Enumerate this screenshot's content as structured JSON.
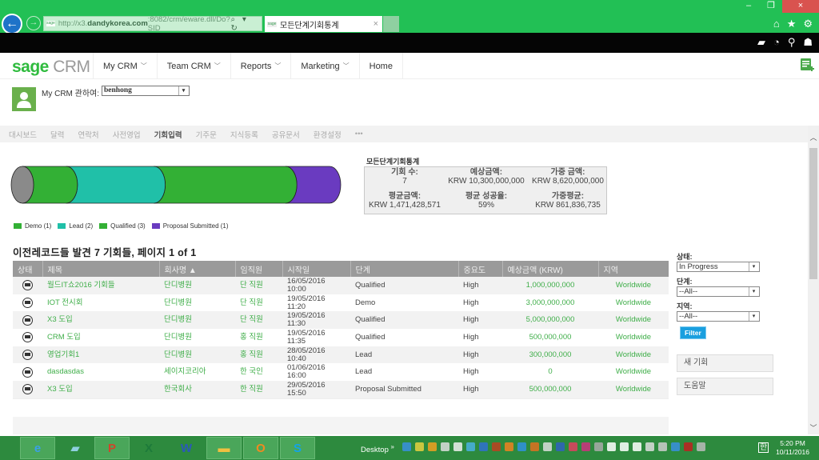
{
  "browser": {
    "url_prefix": "http://x3.",
    "url_domain": "dandykorea.com",
    "url_suffix": ":8082/crm/eware.dll/Do?SID",
    "url_favicon": "sage",
    "addr_controls": "⌕ ▾ ↻",
    "tab_title": "모든단계기회통계",
    "tab_favicon": "sage",
    "tab_close": "×",
    "back": "←",
    "forward": "→",
    "win_minimize": "–",
    "win_restore": "❐",
    "win_close": "×",
    "tools": {
      "home": "⌂",
      "favorites": "★",
      "settings": "⚙"
    }
  },
  "crm_topbar_icons": {
    "notifications": "▰",
    "recent": "◔",
    "search": "⚲",
    "user": "☗"
  },
  "nav": {
    "logo_sage": "sage",
    "logo_crm": " CRM",
    "items": [
      {
        "label": "My CRM",
        "chevron": "﹀"
      },
      {
        "label": "Team CRM",
        "chevron": "﹀"
      },
      {
        "label": "Reports",
        "chevron": "﹀"
      },
      {
        "label": "Marketing",
        "chevron": "﹀"
      },
      {
        "label": "Home",
        "chevron": ""
      }
    ]
  },
  "context": {
    "label": "My CRM 관하여:",
    "selected_user": "benhong",
    "dropdown_glyph": "▾"
  },
  "subtabs": [
    {
      "label": "대시보드",
      "active": false
    },
    {
      "label": "달력",
      "active": false
    },
    {
      "label": "연락처",
      "active": false
    },
    {
      "label": "사전영업",
      "active": false
    },
    {
      "label": "기회입력",
      "active": true
    },
    {
      "label": "기주문",
      "active": false
    },
    {
      "label": "지식등록",
      "active": false
    },
    {
      "label": "공유문서",
      "active": false
    },
    {
      "label": "환경설정",
      "active": false
    },
    {
      "label": "•••",
      "active": false
    }
  ],
  "scrollbar": {
    "up": "︿",
    "down": "﹀"
  },
  "chart_data": {
    "type": "bar",
    "title": "",
    "orientation": "horizontal-stacked-pipeline",
    "categories": [
      "Demo",
      "Lead",
      "Qualified",
      "Proposal Submitted"
    ],
    "values": [
      1,
      2,
      3,
      1
    ],
    "colors": [
      "#33b035",
      "#20c0a8",
      "#33b035",
      "#6a3bc0"
    ],
    "legend": [
      "Demo (1)",
      "Lead (2)",
      "Qualified (3)",
      "Proposal Submitted (1)"
    ],
    "legend_position": "bottom-left",
    "end_cap_color": "#8a8a8a"
  },
  "stats": {
    "title": "모든단계기회통계",
    "items": [
      {
        "label": "기회 수:",
        "value": "7"
      },
      {
        "label": "예상금액:",
        "value": "KRW 10,300,000,000"
      },
      {
        "label": "가중 금액:",
        "value": "KRW 8,620,000,000"
      },
      {
        "label": "평균금액:",
        "value": "KRW 1,471,428,571"
      },
      {
        "label": "평균 성공율:",
        "value": "59%"
      },
      {
        "label": "가중평균:",
        "value": "KRW 861,836,735"
      }
    ]
  },
  "list": {
    "title": "이전레코드들 발견 7 기회들, 페이지 1 of 1",
    "columns": [
      "상태",
      "제목",
      "회사명 ▲",
      "임직원",
      "시작일",
      "단계",
      "중요도",
      "예상금액 (KRW)",
      "지역"
    ],
    "rows": [
      {
        "title": "월드IT쇼2016 기회들",
        "company": "단디병원",
        "person": "단 직원",
        "date": "16/05/2016",
        "time": "10:00",
        "stage": "Qualified",
        "priority": "High",
        "amount": "1,000,000,000",
        "region": "Worldwide"
      },
      {
        "title": "IOT 전시회",
        "company": "단디병원",
        "person": "단 직원",
        "date": "19/05/2016",
        "time": "11:20",
        "stage": "Demo",
        "priority": "High",
        "amount": "3,000,000,000",
        "region": "Worldwide"
      },
      {
        "title": "X3 도입",
        "company": "단디병원",
        "person": "단 직원",
        "date": "19/05/2016",
        "time": "11:30",
        "stage": "Qualified",
        "priority": "High",
        "amount": "5,000,000,000",
        "region": "Worldwide"
      },
      {
        "title": "CRM 도입",
        "company": "단디병원",
        "person": "홍 직원",
        "date": "19/05/2016",
        "time": "11:35",
        "stage": "Qualified",
        "priority": "High",
        "amount": "500,000,000",
        "region": "Worldwide"
      },
      {
        "title": "영업기회1",
        "company": "단디병원",
        "person": "홍 직원",
        "date": "28/05/2016",
        "time": "10:40",
        "stage": "Lead",
        "priority": "High",
        "amount": "300,000,000",
        "region": "Worldwide"
      },
      {
        "title": "dasdasdas",
        "company": "세이지코리아",
        "person": "한 국인",
        "date": "01/06/2016",
        "time": "16:00",
        "stage": "Lead",
        "priority": "High",
        "amount": "0",
        "region": "Worldwide"
      },
      {
        "title": "X3 도입",
        "company": "한국회사",
        "person": "한 직원",
        "date": "29/05/2016",
        "time": "15:50",
        "stage": "Proposal Submitted",
        "priority": "High",
        "amount": "500,000,000",
        "region": "Worldwide"
      }
    ]
  },
  "filters": {
    "status_label": "상태:",
    "status_value": "In Progress",
    "stage_label": "단계:",
    "stage_value": "--All--",
    "region_label": "지역:",
    "region_value": "--All--",
    "dropdown_glyph": "▾",
    "filter_button": "Filter"
  },
  "actions": {
    "new_opportunity": "새 기회",
    "help": "도움말"
  },
  "taskbar": {
    "apps": [
      {
        "name": "internet-explorer",
        "glyph": "e",
        "color": "#3aa0e8"
      },
      {
        "name": "notes",
        "glyph": "▰",
        "color": "#8fd0e0"
      },
      {
        "name": "powerpoint",
        "glyph": "P",
        "color": "#d0452a"
      },
      {
        "name": "excel",
        "glyph": "X",
        "color": "#1d7a3a"
      },
      {
        "name": "word",
        "glyph": "W",
        "color": "#2a5ab8"
      },
      {
        "name": "file-explorer",
        "glyph": "▬",
        "color": "#f0c040"
      },
      {
        "name": "outlook",
        "glyph": "O",
        "color": "#f08a20"
      },
      {
        "name": "skype",
        "glyph": "S",
        "color": "#12a4e8"
      }
    ],
    "desktop_label": "Desktop",
    "overflow": "»",
    "ime": "한",
    "time": "5:20 PM",
    "date": "10/11/2016"
  }
}
